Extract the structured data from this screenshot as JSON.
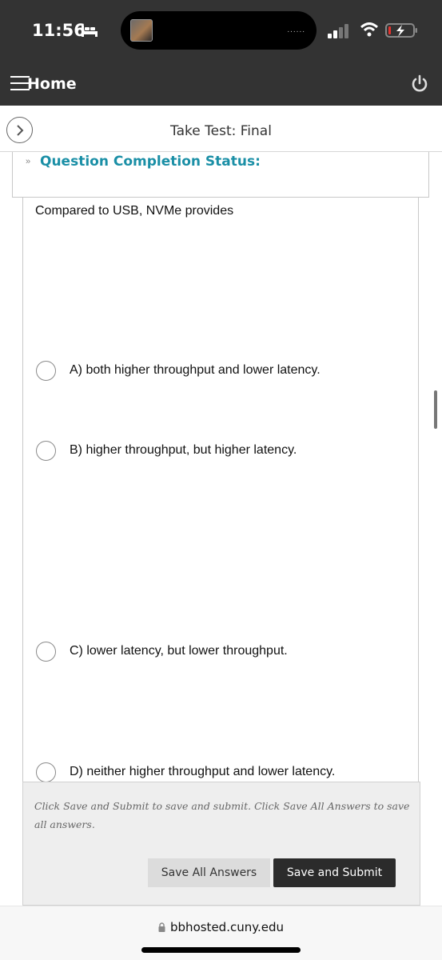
{
  "status_bar": {
    "time": "11:56",
    "island_dots": "......"
  },
  "app_header": {
    "menu_label": "Home"
  },
  "page": {
    "title": "Take Test: Final"
  },
  "completion_status": {
    "chevron": "»",
    "title": "Question Completion Status:"
  },
  "question": {
    "text": "Compared to USB, NVMe provides",
    "options": [
      {
        "label": "A) both higher throughput and lower latency.",
        "selected": false
      },
      {
        "label": "B) higher throughput, but higher latency.",
        "selected": false
      },
      {
        "label": "C) lower latency, but lower throughput.",
        "selected": false
      },
      {
        "label": "D) neither higher throughput and lower latency.",
        "selected": false
      }
    ]
  },
  "footer": {
    "note": "Click Save and Submit to save and submit. Click Save All Answers to save all answers.",
    "save_all_label": "Save All Answers",
    "submit_label": "Save and Submit"
  },
  "browser": {
    "url": "bbhosted.cuny.edu"
  },
  "colors": {
    "header_bg": "#333333",
    "accent": "#1a8fa6",
    "submit_bg": "#2b2b2b",
    "panel_bg": "#eeeeee"
  }
}
